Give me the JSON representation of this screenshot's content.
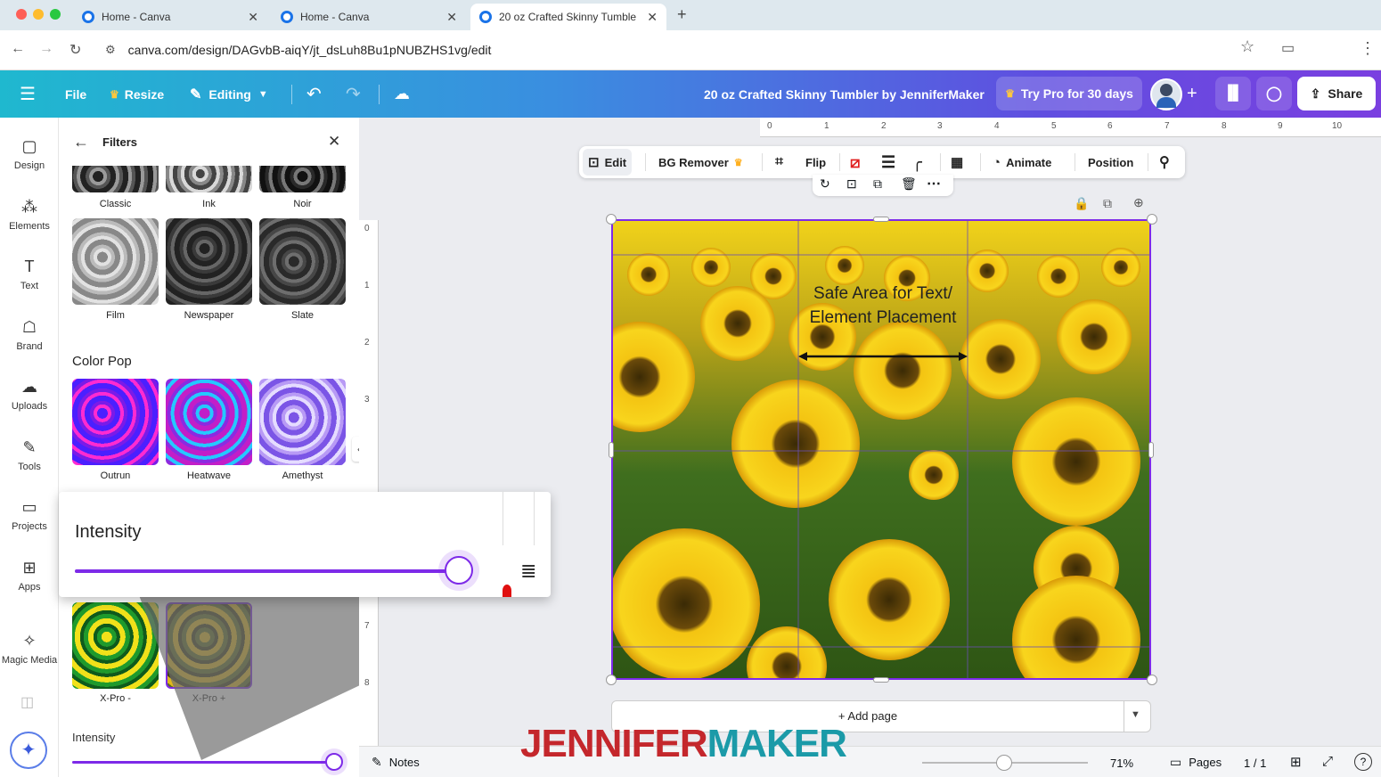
{
  "browser": {
    "tabs": [
      {
        "label": "Home - Canva",
        "active": false
      },
      {
        "label": "Home - Canva",
        "active": false
      },
      {
        "label": "20 oz Crafted Skinny Tumble",
        "active": true
      }
    ],
    "new_tab": "+",
    "url": "canva.com/design/DAGvbB-aiqY/jt_dsLuh8Bu1pNUBZHS1vg/edit"
  },
  "header": {
    "file": "File",
    "resize": "Resize",
    "editing": "Editing",
    "doc_title": "20 oz Crafted Skinny Tumbler by JenniferMaker",
    "try_pro": "Try Pro for 30 days",
    "share": "Share"
  },
  "rail": [
    {
      "label": "Design",
      "icon": "design-icon"
    },
    {
      "label": "Elements",
      "icon": "elements-icon"
    },
    {
      "label": "Text",
      "icon": "text-icon"
    },
    {
      "label": "Brand",
      "icon": "brand-icon"
    },
    {
      "label": "Uploads",
      "icon": "uploads-icon"
    },
    {
      "label": "Tools",
      "icon": "tools-icon"
    },
    {
      "label": "Projects",
      "icon": "projects-icon"
    },
    {
      "label": "Apps",
      "icon": "apps-icon"
    },
    {
      "label": "Magic Media",
      "icon": "magic-media-icon"
    }
  ],
  "panel": {
    "title": "Filters",
    "row1": [
      "Classic",
      "Ink",
      "Noir"
    ],
    "row2": [
      "Film",
      "Newspaper",
      "Slate"
    ],
    "section_color_pop": "Color Pop",
    "row3": [
      "Outrun",
      "Heatwave",
      "Amethyst"
    ],
    "row5": [
      "X-Pro -",
      "X-Pro +"
    ],
    "intensity_label": "Intensity",
    "intensity_value": 0.98
  },
  "popup": {
    "label": "Intensity",
    "value": 0.98
  },
  "toolbar": {
    "edit": "Edit",
    "bg_remover": "BG Remover",
    "flip": "Flip",
    "animate": "Animate",
    "position": "Position"
  },
  "ruler": {
    "h_ticks": [
      "0",
      "1",
      "2",
      "3",
      "4",
      "5",
      "6",
      "7",
      "8",
      "9",
      "10"
    ],
    "v_ticks": [
      "0",
      "1",
      "2",
      "3",
      "7",
      "8"
    ]
  },
  "canvas": {
    "safe_area_line1": "Safe Area for Text/",
    "safe_area_line2": "Element Placement",
    "add_page": "+ Add page"
  },
  "footer": {
    "notes": "Notes",
    "zoom": "71%",
    "zoom_level": 0.71,
    "pages": "Pages",
    "page_count": "1 / 1"
  },
  "watermark": {
    "part1": "JENNIFER",
    "part2": "MAKER"
  },
  "colors": {
    "accent_purple": "#7d2ae8",
    "canva_teal": "#1fb8cf",
    "watermark_red": "#c4272c",
    "watermark_teal": "#1b9aa8"
  }
}
